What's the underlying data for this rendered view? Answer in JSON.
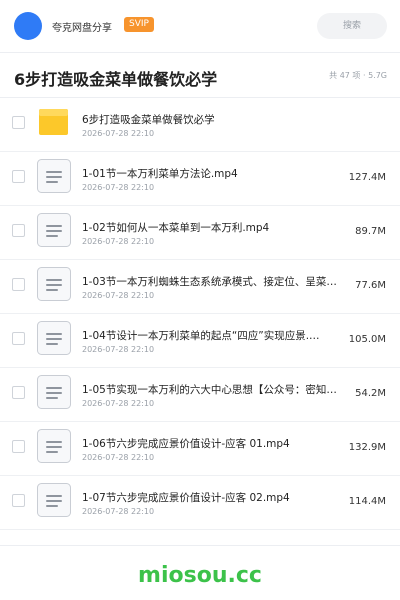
{
  "header": {
    "user_name": "夸克网盘分享",
    "badge": "SVIP",
    "search_placeholder": "搜索",
    "accent_color": "#2f7bf6",
    "badge_color": "#f7942d"
  },
  "folder": {
    "title": "6步打造吸金菜单做餐饮必学",
    "meta": "共 47 项 · 5.7G"
  },
  "files": [
    {
      "type": "folder",
      "icon": "folder-icon",
      "name": "6步打造吸金菜单做餐饮必学",
      "date": "2026-07-28 22:10",
      "size": ""
    },
    {
      "type": "file",
      "icon": "document-icon",
      "name": "1-01节一本万利菜单方法论.mp4",
      "date": "2026-07-28 22:10",
      "size": "127.4M"
    },
    {
      "type": "file",
      "icon": "document-icon",
      "name": "1-02节如何从一本菜单到一本万利.mp4",
      "date": "2026-07-28 22:10",
      "size": "89.7M"
    },
    {
      "type": "file",
      "icon": "document-icon",
      "name": "1-03节一本万利蜘蛛生态系统承模式、接定位、呈菜…",
      "date": "2026-07-28 22:10",
      "size": "77.6M"
    },
    {
      "type": "file",
      "icon": "document-icon",
      "name": "1-04节设计一本万利菜单的起点“四应”实现应景.…",
      "date": "2026-07-28 22:10",
      "size": "105.0M"
    },
    {
      "type": "file",
      "icon": "document-icon",
      "name": "1-05节实现一本万利的六大中心思想【公众号：密知…",
      "date": "2026-07-28 22:10",
      "size": "54.2M"
    },
    {
      "type": "file",
      "icon": "document-icon",
      "name": "1-06节六步完成应景价值设计-应客 01.mp4",
      "date": "2026-07-28 22:10",
      "size": "132.9M"
    },
    {
      "type": "file",
      "icon": "document-icon",
      "name": "1-07节六步完成应景价值设计-应客 02.mp4",
      "date": "2026-07-28 22:10",
      "size": "114.4M"
    }
  ],
  "watermark": "miosou.cc"
}
